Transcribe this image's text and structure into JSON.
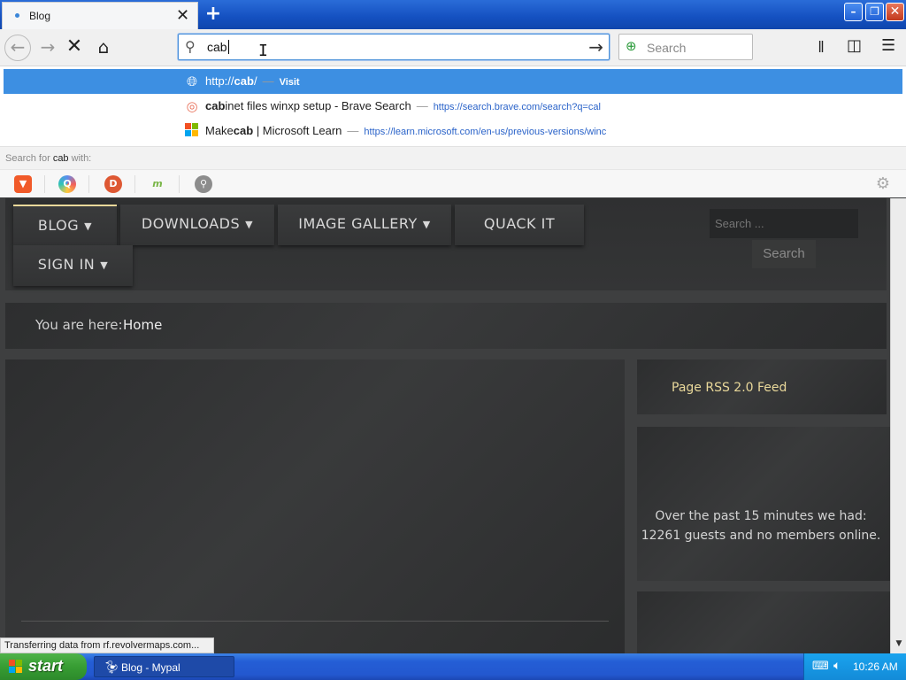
{
  "browser": {
    "tab": {
      "title": "Blog"
    },
    "address_bar": {
      "value": "cab"
    },
    "search_bar": {
      "placeholder": "Search"
    },
    "suggestions": [
      {
        "pre": "http://",
        "bold": "cab",
        "post": "/",
        "sep": "—",
        "url": "Visit",
        "icon": "globe-icon"
      },
      {
        "pre": "",
        "bold": "cab",
        "post": "inet files winxp setup - Brave Search",
        "sep": "—",
        "url": "https://search.brave.com/search?q=cal",
        "icon": "brave-search-icon"
      },
      {
        "pre": "Make",
        "bold": "cab",
        "post": " | Microsoft Learn",
        "sep": "—",
        "url": "https://learn.microsoft.com/en-us/previous-versions/winc",
        "icon": "microsoft-icon"
      }
    ],
    "search_for": {
      "prefix": "Search for ",
      "term": "cab",
      "suffix": " with:"
    },
    "engines": [
      "brave-icon",
      "qwant-icon",
      "duckduckgo-icon",
      "mojeek-icon",
      "search-engine-icon"
    ],
    "status": "Transferring data from rf.revolvermaps.com..."
  },
  "site": {
    "nav": [
      {
        "label": "BLOG",
        "has_menu": true
      },
      {
        "label": "DOWNLOADS",
        "has_menu": true
      },
      {
        "label": "IMAGE GALLERY",
        "has_menu": true
      },
      {
        "label": "QUACK IT",
        "has_menu": false
      },
      {
        "label": "SIGN IN",
        "has_menu": true
      }
    ],
    "search": {
      "placeholder": "Search ...",
      "button": "Search"
    },
    "breadcrumb": {
      "label": "You are here:",
      "current": "Home"
    },
    "rss_link": "Page RSS 2.0 Feed",
    "visitors_text": "Over the past 15 minutes we had: 12261 guests and no members online.",
    "nav_accent": "#e9d89a"
  },
  "taskbar": {
    "start_label": "start",
    "task": "Blog - Mypal",
    "clock": "10:26 AM"
  }
}
